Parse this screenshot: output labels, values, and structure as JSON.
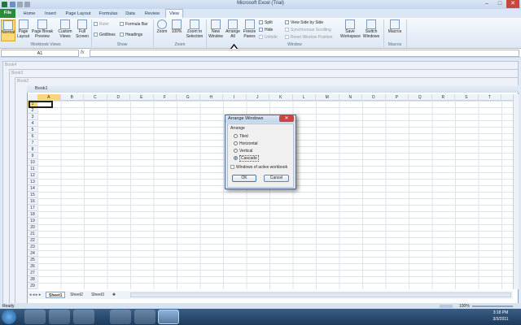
{
  "window": {
    "title": "Microsoft Excel (Trial)",
    "minimize": "–",
    "maximize": "□",
    "close": "✕"
  },
  "tabs": [
    {
      "label": "File"
    },
    {
      "label": "Home"
    },
    {
      "label": "Insert"
    },
    {
      "label": "Page Layout"
    },
    {
      "label": "Formulas"
    },
    {
      "label": "Data"
    },
    {
      "label": "Review"
    },
    {
      "label": "View"
    }
  ],
  "ribbon": {
    "workbook_views": {
      "group_label": "Workbook Views",
      "normal": "Normal",
      "page_layout": "Page Layout",
      "page_break_preview": "Page Break Preview",
      "custom_views": "Custom Views",
      "full_screen": "Full Screen"
    },
    "show": {
      "group_label": "Show",
      "ruler": "Ruler",
      "gridlines": "Gridlines",
      "formula_bar": "Formula Bar",
      "headings": "Headings"
    },
    "zoom": {
      "group_label": "Zoom",
      "zoom": "Zoom",
      "zoom100": "100%",
      "zoom_to_selection": "Zoom to Selection"
    },
    "window": {
      "group_label": "Window",
      "new_window": "New Window",
      "arrange_all": "Arrange All",
      "freeze_panes": "Freeze Panes",
      "split": "Split",
      "hide": "Hide",
      "unhide": "Unhide",
      "view_side_by_side": "View Side by Side",
      "synchronous_scrolling": "Synchronous Scrolling",
      "reset_window_position": "Reset Window Position",
      "save_workspace": "Save Workspace",
      "switch_windows": "Switch Windows"
    },
    "macros": {
      "group_label": "Macros",
      "macros": "Macros"
    }
  },
  "formula_bar": {
    "name_box": "A1",
    "fx": "fx",
    "value": ""
  },
  "stacked_windows": [
    "Book4",
    "Book3",
    "Book2"
  ],
  "workbook": {
    "title": "Book1",
    "columns": [
      "A",
      "B",
      "C",
      "D",
      "E",
      "F",
      "G",
      "H",
      "I",
      "J",
      "K",
      "L",
      "M",
      "N",
      "O",
      "P",
      "Q",
      "R",
      "S",
      "T"
    ],
    "rows": [
      "1",
      "2",
      "3",
      "4",
      "5",
      "6",
      "7",
      "8",
      "9",
      "10",
      "11",
      "12",
      "13",
      "14",
      "15",
      "16",
      "17",
      "18",
      "19",
      "20",
      "21",
      "22",
      "23",
      "24",
      "25",
      "26",
      "27",
      "28",
      "29"
    ],
    "sheets": [
      "Sheet1",
      "Sheet2",
      "Sheet3"
    ]
  },
  "dialog": {
    "title": "Arrange Windows",
    "section": "Arrange",
    "options": [
      "Tiled",
      "Horizontal",
      "Vertical",
      "Cascade"
    ],
    "selected": "Cascade",
    "checkbox": "Windows of active workbook",
    "ok": "OK",
    "cancel": "Cancel"
  },
  "status": {
    "ready": "Ready",
    "zoom": "100%"
  },
  "taskbar": {
    "time": "3:18 PM",
    "date": "3/3/2011"
  }
}
